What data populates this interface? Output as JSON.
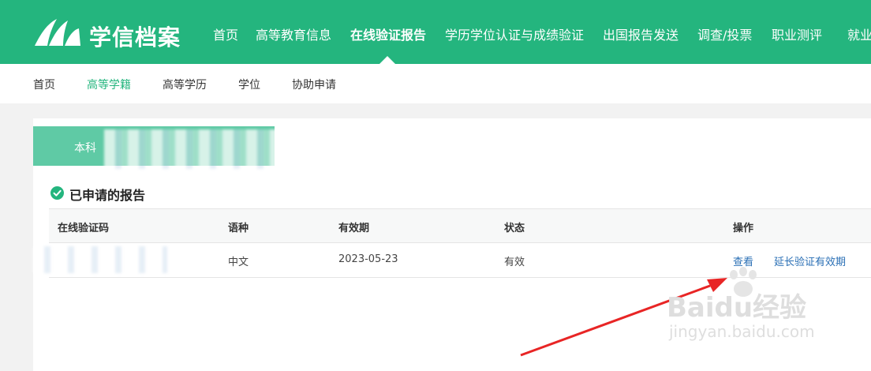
{
  "header": {
    "logo_text": "学信档案",
    "nav": [
      "首页",
      "高等教育信息",
      "在线验证报告",
      "学历学位认证与成绩验证",
      "出国报告发送",
      "调查/投票",
      "职业测评",
      "就业"
    ]
  },
  "subnav": [
    "首页",
    "高等学籍",
    "高等学历",
    "学位",
    "协助申请"
  ],
  "degree_label": "本科",
  "section_title": "已申请的报告",
  "table": {
    "headers": [
      "在线验证码",
      "语种",
      "有效期",
      "状态",
      "操作"
    ],
    "rows": [
      {
        "code": "",
        "language": "中文",
        "expiry": "2023-05-23",
        "status": "有效",
        "view": "查看",
        "extend": "延长验证有效期"
      }
    ]
  },
  "watermark": {
    "brand": "Baidu经验",
    "url": "jingyan.baidu.com"
  },
  "colors": {
    "brand_green": "#24b57e",
    "link_blue": "#2a6fb5",
    "arrow_red": "#e82525"
  }
}
